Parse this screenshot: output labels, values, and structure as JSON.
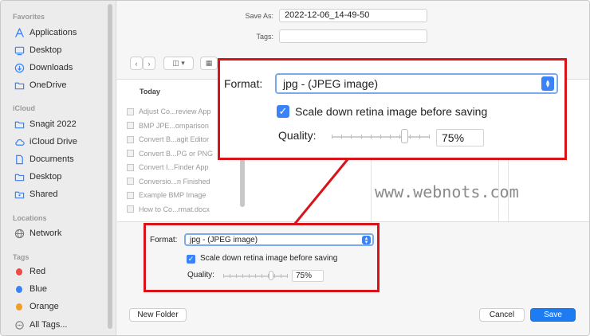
{
  "sidebar": {
    "sections": [
      {
        "title": "Favorites",
        "items": [
          {
            "label": "Applications",
            "icon": "applications-icon"
          },
          {
            "label": "Desktop",
            "icon": "desktop-icon"
          },
          {
            "label": "Downloads",
            "icon": "downloads-icon"
          },
          {
            "label": "OneDrive",
            "icon": "folder-icon"
          }
        ]
      },
      {
        "title": "iCloud",
        "items": [
          {
            "label": "Snagit 2022",
            "icon": "folder-icon"
          },
          {
            "label": "iCloud Drive",
            "icon": "cloud-icon"
          },
          {
            "label": "Documents",
            "icon": "document-icon"
          },
          {
            "label": "Desktop",
            "icon": "folder-icon"
          },
          {
            "label": "Shared",
            "icon": "shared-folder-icon"
          }
        ]
      },
      {
        "title": "Locations",
        "items": [
          {
            "label": "Network",
            "icon": "network-icon"
          }
        ]
      },
      {
        "title": "Tags",
        "items": [
          {
            "label": "Red",
            "color": "#ee4a45"
          },
          {
            "label": "Blue",
            "color": "#3a82f7"
          },
          {
            "label": "Orange",
            "color": "#f39a27"
          },
          {
            "label": "All Tags...",
            "icon": "tags-icon"
          }
        ]
      }
    ]
  },
  "save_as": {
    "label": "Save As:",
    "value": "2022-12-06_14-49-50"
  },
  "tags": {
    "label": "Tags:",
    "value": ""
  },
  "browser": {
    "column_header": "Today",
    "files": [
      "Adjust Co...review App",
      "BMP JPE...omparison",
      "Convert B...agit Editor",
      "Convert B...PG or PNG",
      "Convert I...Finder App",
      "Conversio...n Finished",
      "Example BMP Image",
      "How to Co...rmat.docx"
    ]
  },
  "options": {
    "format_label": "Format:",
    "format_value": "jpg - (JPEG image)",
    "scale_label": "Scale down retina image before saving",
    "scale_checked": true,
    "quality_label": "Quality:",
    "quality_value": "75%",
    "quality_level": 0.75
  },
  "footer": {
    "new_folder": "New Folder",
    "cancel": "Cancel",
    "save": "Save"
  },
  "watermark": "www.webnots.com",
  "colors": {
    "accent": "#3a82f7",
    "callout": "#d8131a"
  }
}
